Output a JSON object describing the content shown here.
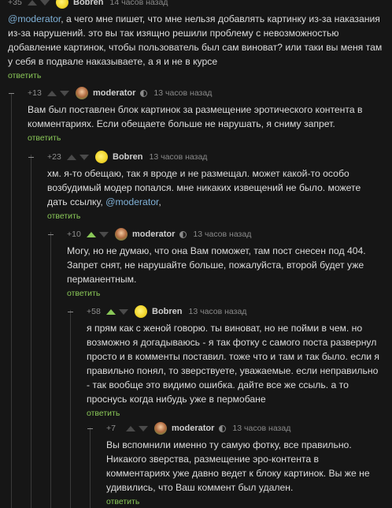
{
  "comments": [
    {
      "score": "+35",
      "user": "Bobren",
      "time": "14 часов назад",
      "mention": "@moderator",
      "text": ", а чего мне пишет, что мне нельзя добавлять картинку из-за наказания из-за нарушений. это вы так изящно решили проблему с невозможностью добавление картинок, чтобы пользователь был сам виноват? или таки вы меня там у себя в подвале наказываете, а я и не в курсе",
      "reply": "ответить"
    },
    {
      "score": "+13",
      "user": "moderator",
      "time": "13 часов назад",
      "text": "Вам был поставлен блок картинок за размещение эротического контента в комментариях. Если обещаете больше не нарушать, я сниму запрет.",
      "reply": "ответить"
    },
    {
      "score": "+23",
      "user": "Bobren",
      "time": "13 часов назад",
      "text": "хм. я-то обещаю, так я вроде и не размещал. может какой-то особо возбудимый модер попался. мне никаких извещений не было. можете дать ссылку, ",
      "mention": "@moderator",
      "tail": ",",
      "reply": "ответить"
    },
    {
      "score": "+10",
      "user": "moderator",
      "time": "13 часов назад",
      "text": "Могу, но не думаю, что она Вам поможет, там пост снесен под 404. Запрет снят, не нарушайте больше, пожалуйста, второй будет уже перманентным.",
      "reply": "ответить"
    },
    {
      "score": "+58",
      "user": "Bobren",
      "time": "13 часов назад",
      "text": "я прям как с женой говорю. ты виноват, но не пойми в чем. но возможно я догадываюсь - я так фотку с самого поста развернул просто и в комменты поставил. тоже что и там и так было. если я правильно понял, то зверствуете, уважаемые. если неправильно - так вообще это видимо ошибка. дайте все же ссыль. а то проснусь когда нибудь уже в пермобане",
      "reply": "ответить"
    },
    {
      "score": "+7",
      "user": "moderator",
      "time": "13 часов назад",
      "text": "Вы вспомнили именно ту самую фотку, все правильно. Никакого зверства, размещение эро-контента в комментариях уже давно ведет к блоку картинок. Вы же не удивились, что Ваш коммент был удален.",
      "reply": "ответить"
    }
  ]
}
